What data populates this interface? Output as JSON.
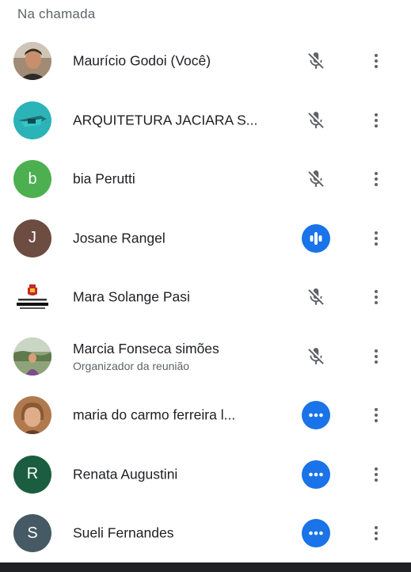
{
  "panel": {
    "section_title": "Na chamada"
  },
  "participants": [
    {
      "name": "Maurício Godoi (Você)",
      "subtitle": "",
      "avatar_type": "photo",
      "status": "muted"
    },
    {
      "name": "ARQUITETURA JACIARA S...",
      "subtitle": "",
      "avatar_type": "logo",
      "status": "muted"
    },
    {
      "name": "bia Perutti",
      "subtitle": "",
      "avatar_type": "letter",
      "initial": "b",
      "avatar_color": "#4caf50",
      "status": "muted"
    },
    {
      "name": "Josane Rangel",
      "subtitle": "",
      "avatar_type": "letter",
      "initial": "J",
      "avatar_color": "#6d4c41",
      "status": "speaking"
    },
    {
      "name": "Mara Solange Pasi",
      "subtitle": "",
      "avatar_type": "emblem",
      "status": "muted"
    },
    {
      "name": "Marcia Fonseca simões",
      "subtitle": "Organizador da reunião",
      "avatar_type": "photo",
      "status": "muted"
    },
    {
      "name": "maria do carmo ferreira l...",
      "subtitle": "",
      "avatar_type": "photo",
      "status": "unmuted"
    },
    {
      "name": "Renata Augustini",
      "subtitle": "",
      "avatar_type": "letter",
      "initial": "R",
      "avatar_color": "#1b5e3f",
      "status": "unmuted"
    },
    {
      "name": "Sueli Fernandes",
      "subtitle": "",
      "avatar_type": "letter",
      "initial": "S",
      "avatar_color": "#455a64",
      "status": "unmuted"
    }
  ],
  "icons": {
    "muted": "mic-off-icon",
    "speaking": "audio-level-icon",
    "unmuted": "audio-idle-icon",
    "more": "more-vert-icon"
  },
  "colors": {
    "accent_blue": "#1a73e8",
    "icon_grey": "#5f6368",
    "text_primary": "#202124",
    "text_secondary": "#5f6368"
  }
}
